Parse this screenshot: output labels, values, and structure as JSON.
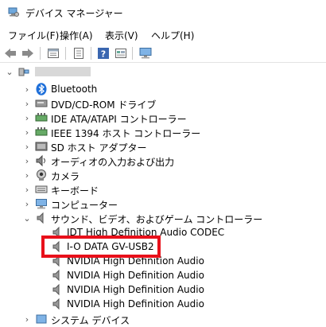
{
  "window": {
    "title": "デバイス マネージャー",
    "icon": "device-manager-icon"
  },
  "menu": [
    "ファイル(F)",
    "操作(A)",
    "表示(V)",
    "ヘルプ(H)"
  ],
  "toolbar": {
    "icons": [
      "back-arrow-icon",
      "forward-arrow-icon",
      "properties-icon",
      "update-driver-icon",
      "help-icon",
      "view-icon",
      "monitor-icon"
    ]
  },
  "tree": {
    "root": {
      "label": ""
    },
    "categories": [
      {
        "label": "Bluetooth",
        "icon": "bluetooth-icon",
        "expanded": false
      },
      {
        "label": "DVD/CD-ROM ドライブ",
        "icon": "dvd-drive-icon",
        "expanded": false
      },
      {
        "label": "IDE ATA/ATAPI コントローラー",
        "icon": "ide-controller-icon",
        "expanded": false
      },
      {
        "label": "IEEE 1394 ホスト コントローラー",
        "icon": "ieee1394-icon",
        "expanded": false
      },
      {
        "label": "SD ホスト アダプター",
        "icon": "sd-host-icon",
        "expanded": false
      },
      {
        "label": "オーディオの入力および出力",
        "icon": "audio-io-icon",
        "expanded": false
      },
      {
        "label": "カメラ",
        "icon": "camera-icon",
        "expanded": false
      },
      {
        "label": "キーボード",
        "icon": "keyboard-icon",
        "expanded": false
      },
      {
        "label": "コンピューター",
        "icon": "computer-icon",
        "expanded": false
      },
      {
        "label": "サウンド、ビデオ、およびゲーム コントローラー",
        "icon": "speaker-icon",
        "expanded": true
      },
      {
        "label": "IDT High Definition Audio CODEC",
        "icon": "speaker-icon",
        "child": true
      },
      {
        "label": "I-O DATA GV-USB2",
        "icon": "speaker-icon",
        "child": true,
        "highlighted": true
      },
      {
        "label": "NVIDIA High Definition Audio",
        "icon": "speaker-icon",
        "child": true
      },
      {
        "label": "NVIDIA High Definition Audio",
        "icon": "speaker-icon",
        "child": true
      },
      {
        "label": "NVIDIA High Definition Audio",
        "icon": "speaker-icon",
        "child": true
      },
      {
        "label": "NVIDIA High Definition Audio",
        "icon": "speaker-icon",
        "child": true
      },
      {
        "label": "システム デバイス",
        "icon": "system-device-icon",
        "expanded": false
      }
    ]
  },
  "colors": {
    "highlight": "#e8101a",
    "bluetooth": "#1e6fd9"
  }
}
